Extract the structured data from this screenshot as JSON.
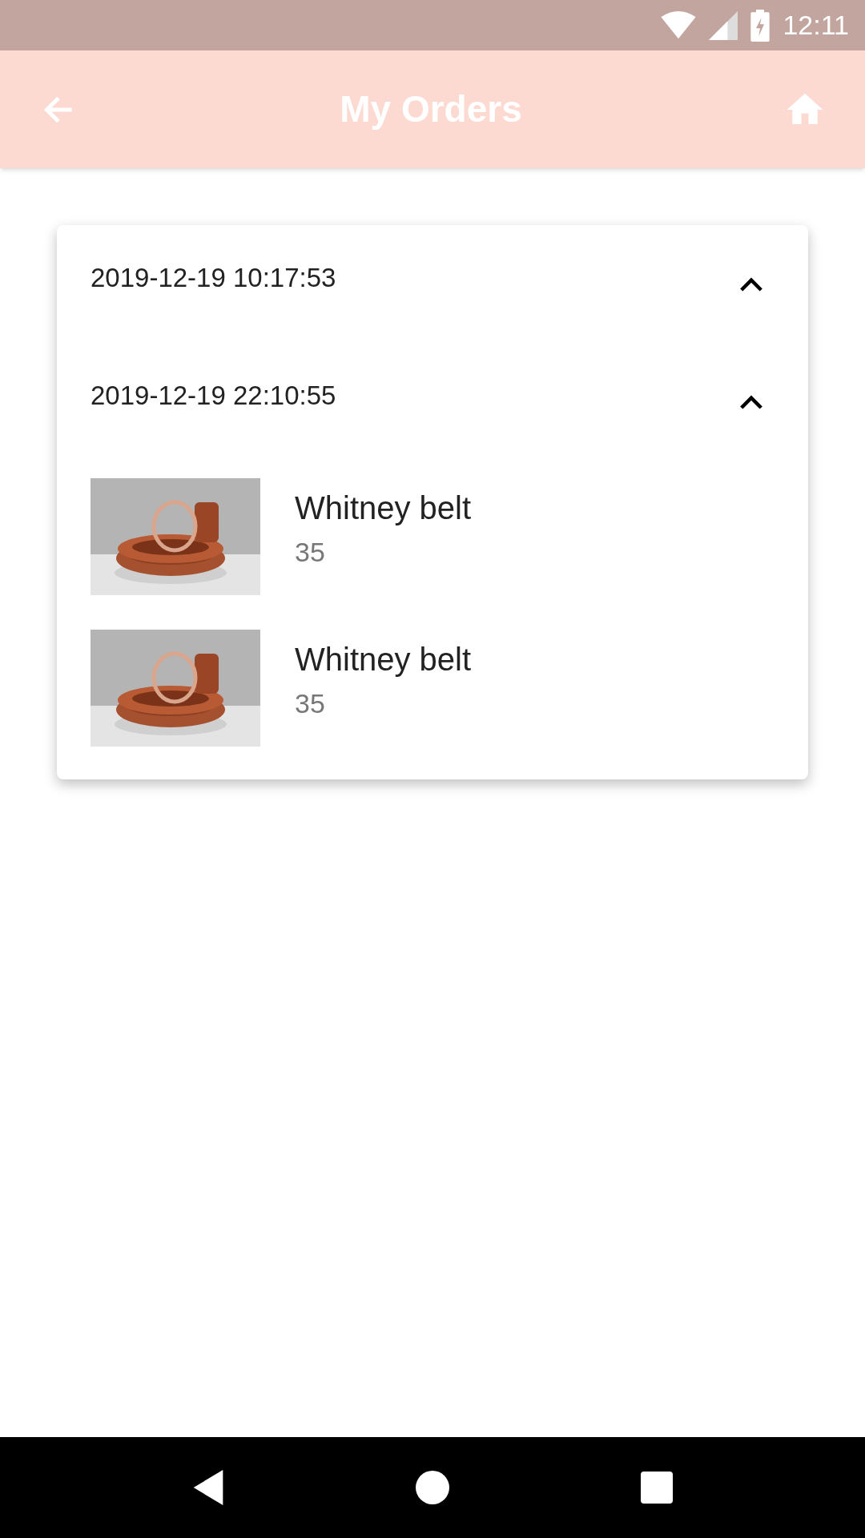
{
  "status_bar": {
    "time": "12:11"
  },
  "app_bar": {
    "title": "My Orders"
  },
  "orders": [
    {
      "date": "2019-12-19 10:17:53",
      "expanded": true
    },
    {
      "date": "2019-12-19 22:10:55",
      "expanded": true,
      "items": [
        {
          "kind": "picture",
          "name": "Whitney belt",
          "price": "35"
        },
        {
          "kind": "picture",
          "name": "Whitney belt",
          "price": "35"
        }
      ]
    }
  ]
}
